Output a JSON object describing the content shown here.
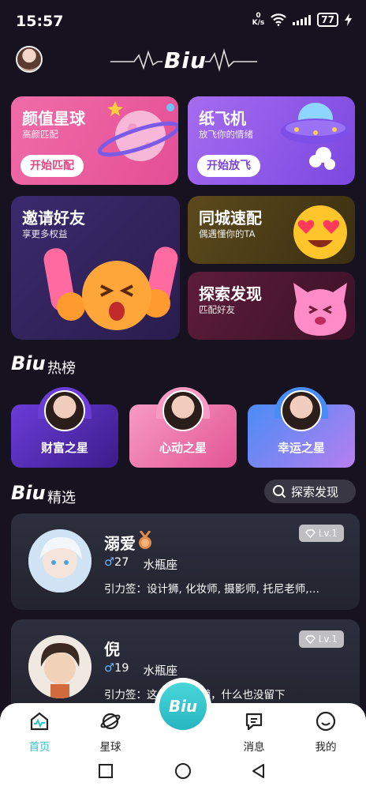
{
  "status_bar": {
    "time": "15:57",
    "net_speed_top": "0",
    "net_speed_unit": "K/s",
    "battery": "77"
  },
  "header": {
    "logo": "Biu"
  },
  "cards": {
    "face": {
      "title": "颜值星球",
      "sub": "高颜匹配",
      "button": "开始匹配"
    },
    "plane": {
      "title": "纸飞机",
      "sub": "放飞你的情绪",
      "button": "开始放飞"
    },
    "invite": {
      "title": "邀请好友",
      "sub": "享更多权益"
    },
    "city": {
      "title": "同城速配",
      "sub": "偶遇懂你的TA"
    },
    "explore": {
      "title": "探索发现",
      "sub": "匹配好友"
    }
  },
  "hot_section": {
    "logo": "Biu",
    "title": "热榜",
    "items": [
      {
        "label": "财富之星"
      },
      {
        "label": "心动之星"
      },
      {
        "label": "幸运之星"
      }
    ]
  },
  "featured_section": {
    "logo": "Biu",
    "title": "精选",
    "search_label": "探索发现"
  },
  "users": [
    {
      "name": "溺爱",
      "level": "Lv.1",
      "gender_symbol": "♂",
      "age": "27",
      "zodiac": "水瓶座",
      "tags": "引力签：设计狮, 化妆师, 摄影师, 托尼老师,…"
    },
    {
      "name": "倪",
      "level": "Lv.1",
      "gender_symbol": "♂",
      "age": "19",
      "zodiac": "水瓶座",
      "tags": "引力签：这个家伙很懒，什么也没留下"
    }
  ],
  "bottom_nav": {
    "items": [
      {
        "label": "首页"
      },
      {
        "label": "星球"
      },
      {
        "label": "消息"
      },
      {
        "label": "我的"
      }
    ],
    "center_label": "Biu"
  },
  "colors": {
    "accent": "#34c3cb",
    "background": "#16121f"
  }
}
